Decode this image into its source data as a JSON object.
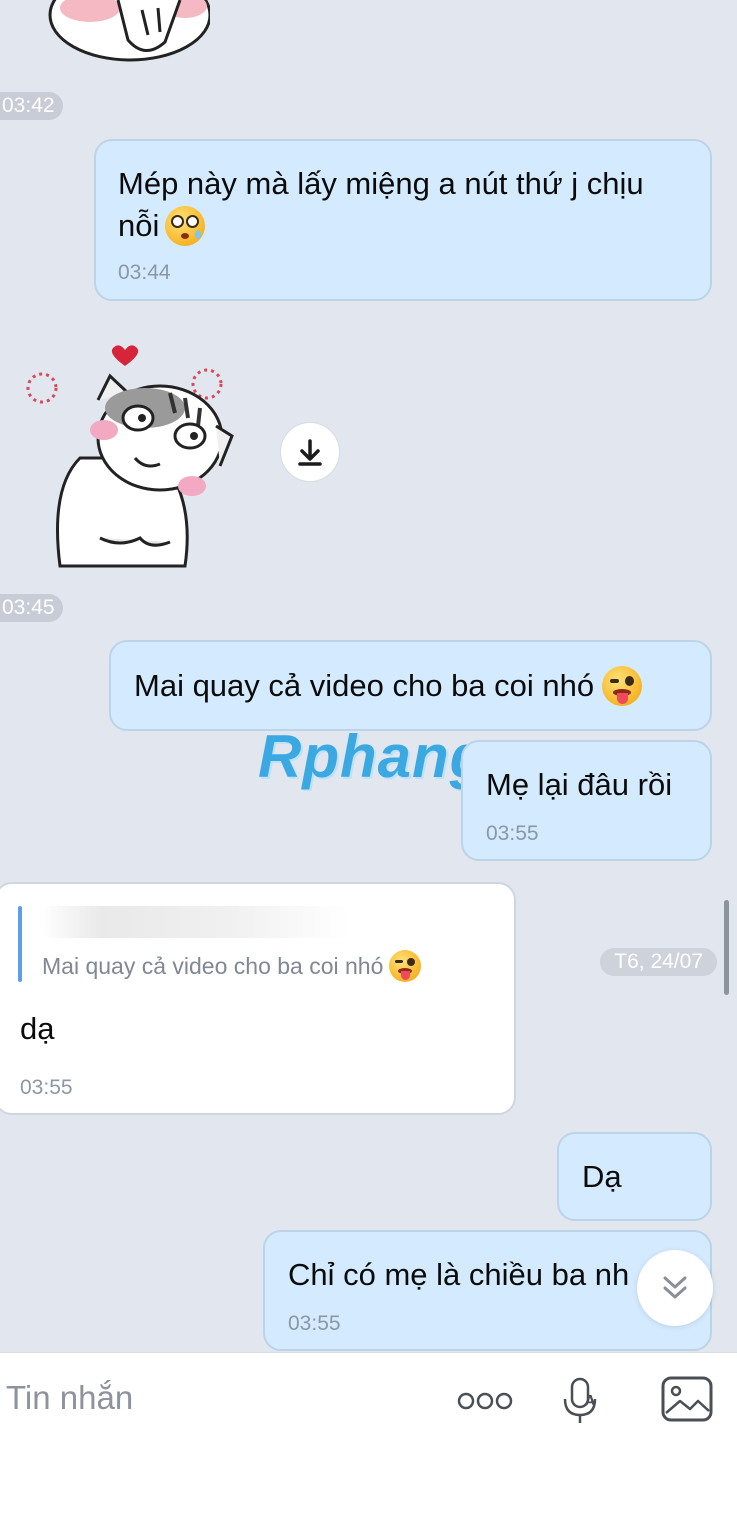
{
  "watermark": "Rphang",
  "times": {
    "t1": "03:42",
    "t2": "03:45",
    "date": "T6, 24/07"
  },
  "messages": [
    {
      "id": "m1",
      "text_line1": "Mép này mà lấy miệng a nút thứ j chịu",
      "text_line2": "nỗi",
      "time": "03:44"
    },
    {
      "id": "m2",
      "text": "Mai quay cả video cho ba coi nhó"
    },
    {
      "id": "m3",
      "text": "Mẹ lại đâu rồi",
      "time": "03:55"
    },
    {
      "id": "m4",
      "quote": "Mai quay cả video cho ba coi nhó",
      "text": "dạ",
      "time": "03:55"
    },
    {
      "id": "m5",
      "text": "Dạ"
    },
    {
      "id": "m6",
      "text": "Chỉ có mẹ là chiều ba nh",
      "time": "03:55"
    }
  ],
  "input": {
    "placeholder": "Tin nhắn"
  },
  "icons": {
    "download": "download-icon",
    "scroll_down": "chevron-double-down-icon",
    "more": "more-icon",
    "voice": "microphone-icon",
    "image": "image-icon"
  },
  "colors": {
    "background": "#e2e6ef",
    "outgoing_bubble": "#d4ebff",
    "incoming_bubble": "#ffffff",
    "timestamp": "#8b97a5"
  }
}
